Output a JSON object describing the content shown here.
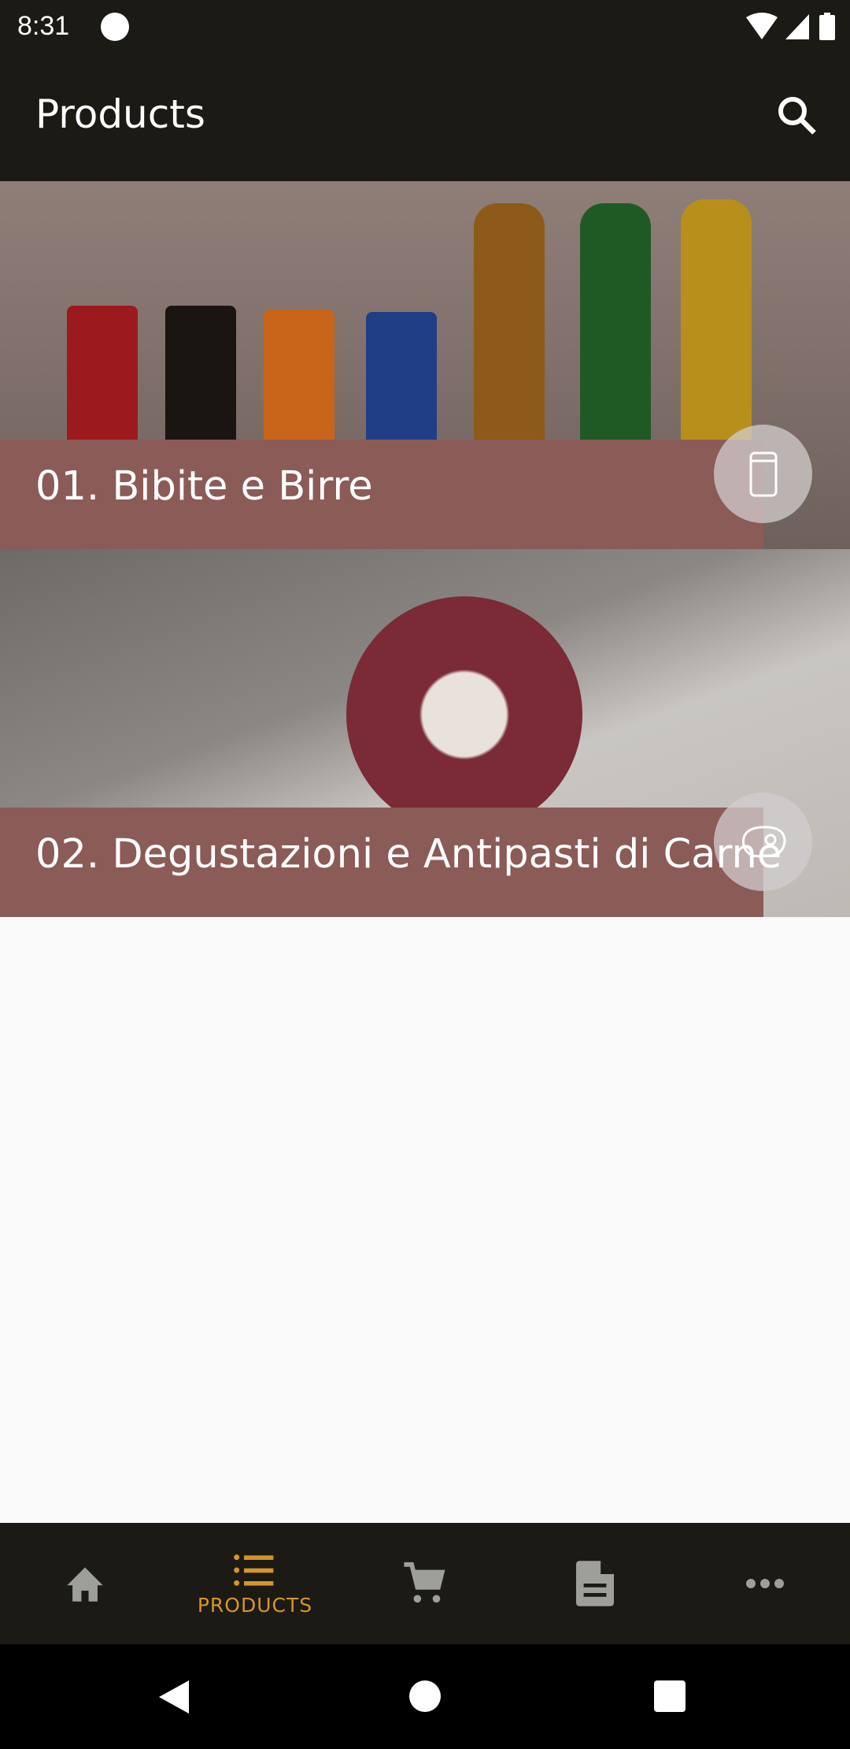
{
  "status_bar": {
    "time": "8:31"
  },
  "toolbar": {
    "title": "Products",
    "search_icon": "search-icon"
  },
  "categories": [
    {
      "label": "01. Bibite e Birre",
      "icon": "can-icon"
    },
    {
      "label": "02. Degustazioni e Antipasti di Carne",
      "icon": "steak-icon"
    }
  ],
  "bottom_nav": {
    "items": [
      {
        "icon": "home-icon",
        "label": ""
      },
      {
        "icon": "list-icon",
        "label": "PRODUCTS",
        "active": true
      },
      {
        "icon": "cart-icon",
        "label": ""
      },
      {
        "icon": "document-icon",
        "label": ""
      },
      {
        "icon": "more-icon",
        "label": ""
      }
    ],
    "active_color": "#d4962a",
    "inactive_color": "#9e9e9a"
  }
}
